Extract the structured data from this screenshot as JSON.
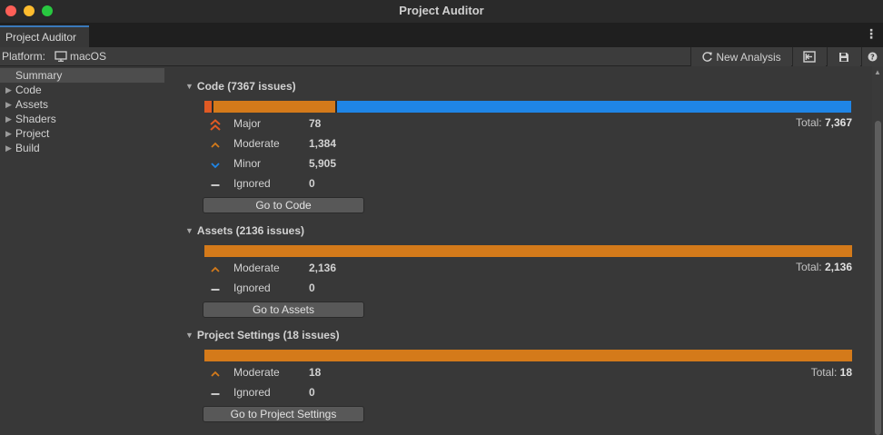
{
  "window": {
    "title": "Project Auditor"
  },
  "tabs": [
    {
      "label": "Project Auditor"
    }
  ],
  "toolbar": {
    "platform_label": "Platform:",
    "platform_value": "macOS",
    "new_analysis_label": "New Analysis"
  },
  "sidebar": {
    "items": [
      {
        "label": "Summary",
        "selected": true
      },
      {
        "label": "Code"
      },
      {
        "label": "Assets"
      },
      {
        "label": "Shaders"
      },
      {
        "label": "Project"
      },
      {
        "label": "Build"
      }
    ]
  },
  "colors": {
    "major": "#e05a24",
    "moderate": "#d47a1a",
    "minor": "#1f85e6",
    "ignored": "#c8c8c8"
  },
  "sections": {
    "code": {
      "title": "Code (7367 issues)",
      "total_label": "Total:",
      "total_value": "7,367",
      "go_button": "Go to Code",
      "distribution": {
        "major": 78,
        "moderate": 1384,
        "minor": 5905
      },
      "rows": [
        {
          "label": "Major",
          "count": "78"
        },
        {
          "label": "Moderate",
          "count": "1,384"
        },
        {
          "label": "Minor",
          "count": "5,905"
        },
        {
          "label": "Ignored",
          "count": "0"
        }
      ]
    },
    "assets": {
      "title": "Assets (2136 issues)",
      "total_label": "Total:",
      "total_value": "2,136",
      "go_button": "Go to Assets",
      "rows": [
        {
          "label": "Moderate",
          "count": "2,136"
        },
        {
          "label": "Ignored",
          "count": "0"
        }
      ]
    },
    "settings": {
      "title": "Project Settings (18 issues)",
      "total_label": "Total:",
      "total_value": "18",
      "go_button": "Go to Project Settings",
      "rows": [
        {
          "label": "Moderate",
          "count": "18"
        },
        {
          "label": "Ignored",
          "count": "0"
        }
      ]
    }
  }
}
